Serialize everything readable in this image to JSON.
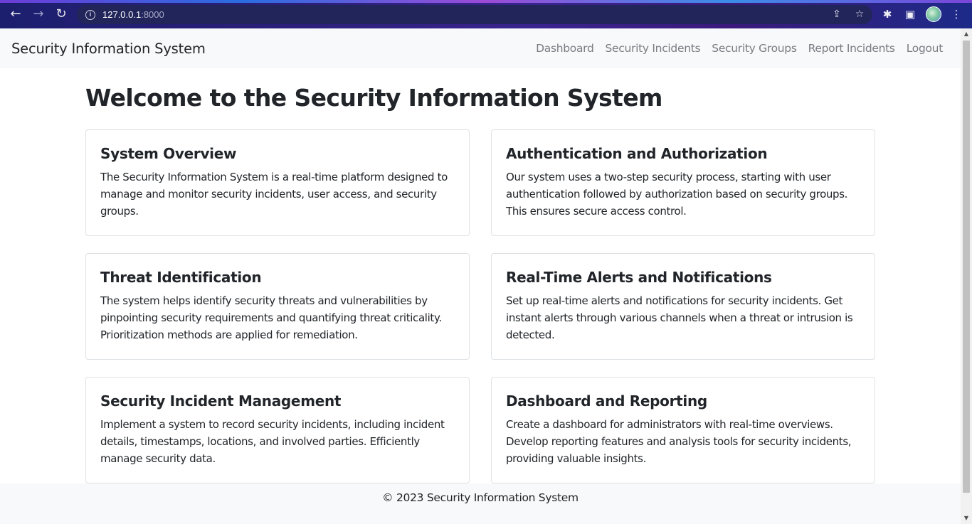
{
  "browser": {
    "url_host": "127.0.0.1",
    "url_port": ":8000",
    "back_icon": "←",
    "forward_icon": "→",
    "reload_icon": "↻",
    "info_icon": "i",
    "share_icon": "⇪",
    "star_icon": "☆",
    "extensions_icon": "✱",
    "sidepanel_icon": "▣",
    "menu_icon": "⋮"
  },
  "navbar": {
    "brand": "Security Information System",
    "links": [
      "Dashboard",
      "Security Incidents",
      "Security Groups",
      "Report Incidents",
      "Logout"
    ]
  },
  "main": {
    "title": "Welcome to the Security Information System",
    "cards": [
      {
        "title": "System Overview",
        "text": "The Security Information System is a real-time platform designed to manage and monitor security incidents, user access, and security groups."
      },
      {
        "title": "Authentication and Authorization",
        "text": "Our system uses a two-step security process, starting with user authentication followed by authorization based on security groups. This ensures secure access control."
      },
      {
        "title": "Threat Identification",
        "text": "The system helps identify security threats and vulnerabilities by pinpointing security requirements and quantifying threat criticality. Prioritization methods are applied for remediation."
      },
      {
        "title": "Real-Time Alerts and Notifications",
        "text": "Set up real-time alerts and notifications for security incidents. Get instant alerts through various channels when a threat or intrusion is detected."
      },
      {
        "title": "Security Incident Management",
        "text": "Implement a system to record security incidents, including incident details, timestamps, locations, and involved parties. Efficiently manage security data."
      },
      {
        "title": "Dashboard and Reporting",
        "text": "Create a dashboard for administrators with real-time overviews. Develop reporting features and analysis tools for security incidents, providing valuable insights."
      }
    ]
  },
  "footer": {
    "text": "© 2023 Security Information System"
  },
  "colors": {
    "navbar_bg": "#f8f9fa",
    "nav_link": "#787d82",
    "text": "#212529",
    "card_border": "#dfe2e5"
  }
}
